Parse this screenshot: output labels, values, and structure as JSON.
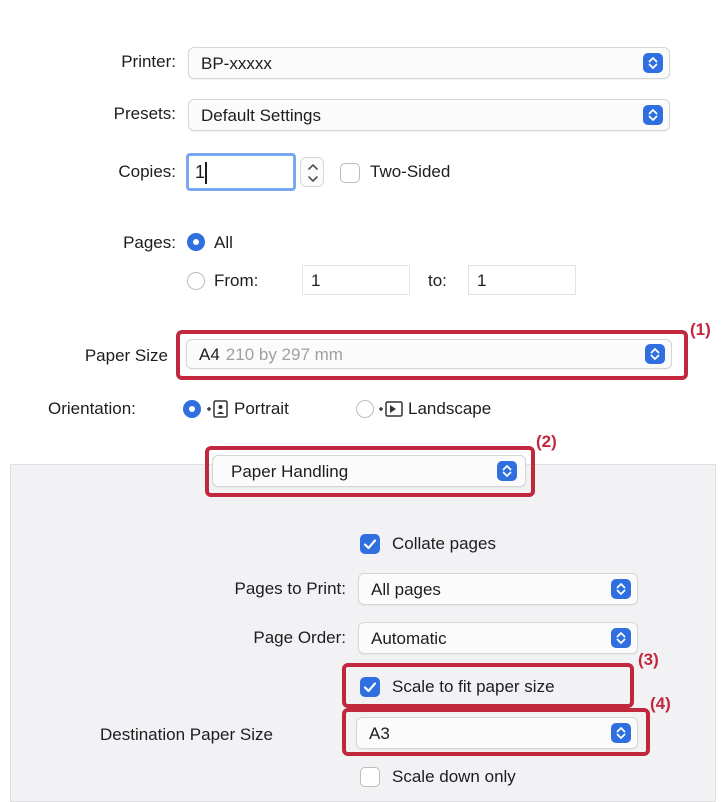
{
  "printer": {
    "label": "Printer:",
    "value": "BP-xxxxx"
  },
  "presets": {
    "label": "Presets:",
    "value": "Default Settings"
  },
  "copies": {
    "label": "Copies:",
    "value": "1",
    "two_sided_label": "Two-Sided"
  },
  "pages": {
    "label": "Pages:",
    "all_label": "All",
    "from_label": "From:",
    "from_value": "1",
    "to_label": "to:",
    "to_value": "1"
  },
  "paper_size": {
    "label": "Paper Size",
    "value": "A4",
    "detail": "210 by 297 mm"
  },
  "orientation": {
    "label": "Orientation:",
    "portrait_label": "Portrait",
    "landscape_label": "Landscape"
  },
  "section_popup": {
    "value": "Paper Handling"
  },
  "paper_handling": {
    "collate_label": "Collate pages",
    "pages_to_print_label": "Pages to Print:",
    "pages_to_print_value": "All pages",
    "page_order_label": "Page Order:",
    "page_order_value": "Automatic",
    "scale_fit_label": "Scale to fit paper size",
    "dest_size_label": "Destination Paper Size",
    "dest_size_value": "A3",
    "scale_down_label": "Scale down only"
  },
  "callouts": {
    "c1": "(1)",
    "c2": "(2)",
    "c3": "(3)",
    "c4": "(4)"
  },
  "colors": {
    "accent": "#2f6fe0",
    "highlight": "#c1283e"
  }
}
